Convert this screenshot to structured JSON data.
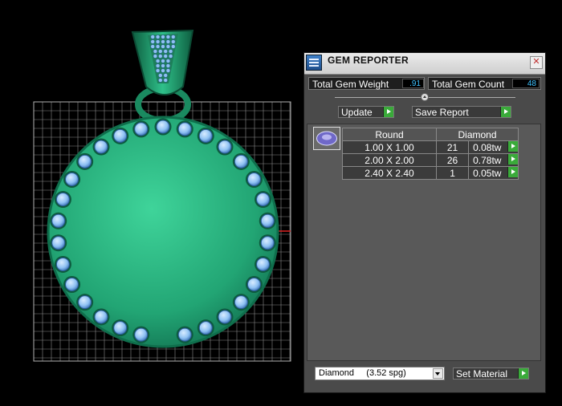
{
  "panel": {
    "title": "GEM REPORTER",
    "close_glyph": "✕",
    "total_gem_weight_label": "Total Gem Weight",
    "total_gem_weight": ".91",
    "total_gem_count_label": "Total Gem Count",
    "total_gem_count": "48",
    "update_label": "Update",
    "save_report_label": "Save Report",
    "table": {
      "headers": [
        "Round",
        "Diamond"
      ],
      "rows": [
        {
          "size": "1.00 X 1.00",
          "count": "21",
          "weight": "0.08tw"
        },
        {
          "size": "2.00 X 2.00",
          "count": "26",
          "weight": "0.78tw"
        },
        {
          "size": "2.40 X 2.40",
          "count": "1",
          "weight": "0.05tw"
        }
      ]
    },
    "material_select": "Diamond     (3.52 spg)",
    "set_material_label": "Set Material"
  },
  "colors": {
    "metal": "#2fb585",
    "gem": "#8fc0f2",
    "grid": "#8a8a8a",
    "accent_green": "#3aaa3a",
    "value_blue": "#3ec2ff"
  },
  "icons": [
    "app-icon",
    "close-icon",
    "gem-shape-icon",
    "dropdown-arrow-icon",
    "play-arrow-icon"
  ]
}
